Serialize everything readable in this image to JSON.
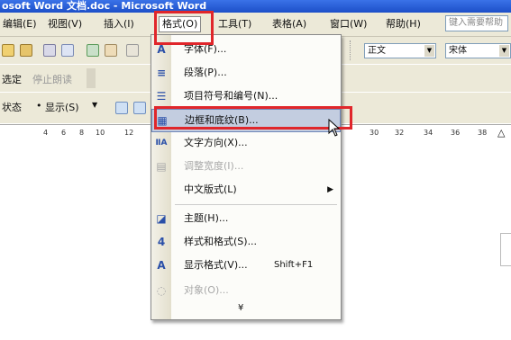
{
  "window": {
    "title": "osoft Word 文档.doc - Microsoft Word"
  },
  "menubar": {
    "items": [
      {
        "label": "编辑(E)"
      },
      {
        "label": "视图(V)"
      },
      {
        "label": "插入(I)"
      },
      {
        "label": "格式(O)"
      },
      {
        "label": "工具(T)"
      },
      {
        "label": "表格(A)"
      },
      {
        "label": "窗口(W)"
      },
      {
        "label": "帮助(H)"
      }
    ],
    "search_placeholder": "键入需要帮助"
  },
  "toolbar": {
    "style_value": "正文",
    "font_value": "宋体",
    "review_label": "选定",
    "stop_label": "停止朗读",
    "status_label": "状态",
    "show_label": "显示(S)"
  },
  "ruler": {
    "numbers": [
      "4",
      "6",
      "8",
      "10",
      "12",
      "30",
      "32",
      "34",
      "36",
      "38"
    ]
  },
  "format_menu": {
    "items": [
      {
        "label": "字体(F)...",
        "icon": "A",
        "disabled": false
      },
      {
        "label": "段落(P)...",
        "icon": "≡",
        "disabled": false
      },
      {
        "label": "项目符号和编号(N)...",
        "icon": "☰",
        "disabled": false
      },
      {
        "label": "边框和底纹(B)...",
        "icon": "▦",
        "disabled": false,
        "highlighted": true
      },
      {
        "label": "文字方向(X)...",
        "icon": "ⅡA",
        "disabled": false
      },
      {
        "label": "调整宽度(I)...",
        "icon": "▤",
        "disabled": true
      },
      {
        "label": "中文版式(L)",
        "icon": "",
        "disabled": false,
        "submenu": true
      },
      {
        "label": "主题(H)...",
        "icon": "◪",
        "disabled": false
      },
      {
        "label": "样式和格式(S)...",
        "icon": "4",
        "disabled": false
      },
      {
        "label": "显示格式(V)...",
        "icon": "A",
        "disabled": false,
        "shortcut": "Shift+F1"
      },
      {
        "label": "对象(O)...",
        "icon": "◌",
        "disabled": true
      }
    ],
    "expand_glyph": "¥"
  },
  "colors": {
    "titlebar": "#1d4fc8",
    "highlight_box": "#e0262b",
    "menu_hover": "#c3cde0"
  }
}
